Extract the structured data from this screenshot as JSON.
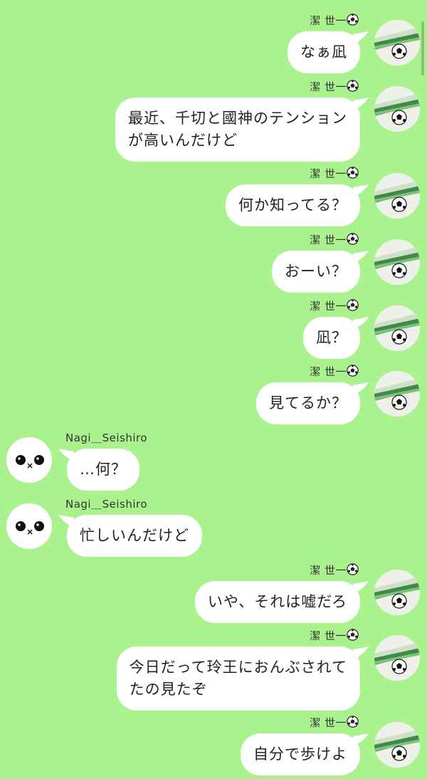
{
  "messages": [
    {
      "side": "right",
      "sender": "潔 世一",
      "lines": [
        "なぁ凪"
      ]
    },
    {
      "side": "right",
      "sender": "潔 世一",
      "lines": [
        "最近、千切と國神のテンション",
        "が高いんだけど"
      ]
    },
    {
      "side": "right",
      "sender": "潔 世一",
      "lines": [
        "何か知ってる？"
      ]
    },
    {
      "side": "right",
      "sender": "潔 世一",
      "lines": [
        "おーい？"
      ]
    },
    {
      "side": "right",
      "sender": "潔 世一",
      "lines": [
        "凪？"
      ]
    },
    {
      "side": "right",
      "sender": "潔 世一",
      "lines": [
        "見てるか？"
      ]
    },
    {
      "side": "left",
      "sender": "Nagi＿Seishiro",
      "lines": [
        "…何？"
      ]
    },
    {
      "side": "left",
      "sender": "Nagi＿Seishiro",
      "lines": [
        "忙しいんだけど"
      ]
    },
    {
      "side": "right",
      "sender": "潔 世一",
      "lines": [
        "いや、それは嘘だろ"
      ]
    },
    {
      "side": "right",
      "sender": "潔 世一",
      "lines": [
        "今日だって玲王におんぶされて",
        "たの見たぞ"
      ]
    },
    {
      "side": "right",
      "sender": "潔 世一",
      "lines": [
        "自分で歩けよ"
      ]
    }
  ],
  "colors": {
    "background": "#aaf28e",
    "bubble": "#ffffff",
    "text": "#222222"
  },
  "icons": {
    "sender_badge": "soccer-ball-icon",
    "right_avatar": "grass-field-soccer-ball-avatar",
    "left_avatar": "white-face-avatar"
  }
}
